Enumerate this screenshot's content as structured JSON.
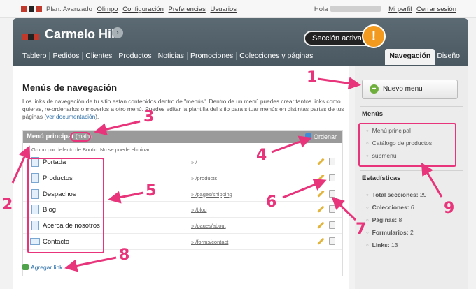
{
  "topbar": {
    "plan": "Plan: Avanzado",
    "links": [
      "Olimpo",
      "Configuración",
      "Preferencias",
      "Usuarios"
    ],
    "greeting": "Hola",
    "profile": "Mi perfil",
    "logout": "Cerrar sesión"
  },
  "header": {
    "store_name": "Carmelo Hill",
    "go_icon": "›",
    "active_section_label": "Sección activa",
    "callout_mark": "!",
    "nav": [
      "Tablero",
      "Pedidos",
      "Clientes",
      "Productos",
      "Noticias",
      "Promociones",
      "Colecciones y páginas"
    ],
    "nav_active": "Navegación",
    "nav_other": "Diseño"
  },
  "main": {
    "title": "Menús de navegación",
    "intro": "Los links de navegación de tu sitio estan contenidos dentro de \"menús\". Dentro de un menú puedes crear tantos links como quieras, re-ordenarlos o moverlos a otro menú. Puedes editar la plantilla del sitio para situar menús en distintas partes de tus páginas (",
    "intro_link": "ver documentación",
    "intro_end": ").",
    "menu": {
      "name": "Menú principal",
      "code": "(main)",
      "order_label": "Ordenar",
      "note": "Grupo por defecto de Bootic. No se puede eliminar.",
      "items": [
        {
          "title": "Portada",
          "url": "/",
          "icon": "page-icon"
        },
        {
          "title": "Productos",
          "url": "/products",
          "icon": "page-icon"
        },
        {
          "title": "Despachos",
          "url": "/pages/shipping",
          "icon": "page-icon"
        },
        {
          "title": "Blog",
          "url": "/blog",
          "icon": "page-icon"
        },
        {
          "title": "Acerca de nosotros",
          "url": "/pages/about",
          "icon": "page-icon"
        },
        {
          "title": "Contacto",
          "url": "/forms/contact",
          "icon": "mail-icon"
        }
      ],
      "add_link": "Agregar link"
    }
  },
  "sidebar": {
    "new_menu_plus": "+",
    "new_menu": "Nuevo menu",
    "menus_title": "Menús",
    "menus": [
      "Menú principal",
      "Catálogo de productos",
      "submenu"
    ],
    "stats_title": "Estadísticas",
    "stats": [
      {
        "label": "Total secciones:",
        "value": "29"
      },
      {
        "label": "Colecciones:",
        "value": "6"
      },
      {
        "label": "Páginas:",
        "value": "8"
      },
      {
        "label": "Formularios:",
        "value": "2"
      },
      {
        "label": "Links:",
        "value": "13"
      }
    ]
  },
  "annotations": [
    "1",
    "2",
    "3",
    "4",
    "5",
    "6",
    "7",
    "8",
    "9"
  ],
  "colors": {
    "annotation": "#e8347a",
    "header": "#4a5861",
    "callout": "#f29a1f",
    "link": "#2b6ea8"
  }
}
